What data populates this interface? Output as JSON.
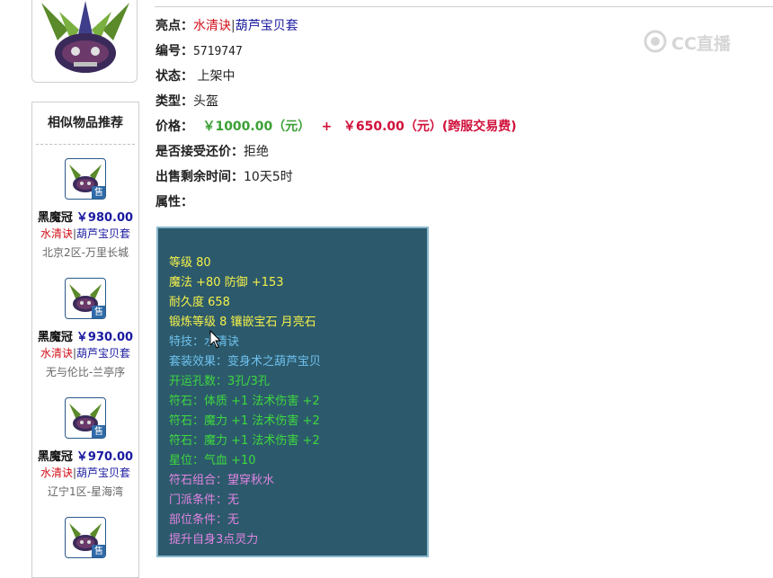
{
  "details": {
    "highlight_label": "亮点：",
    "highlight_tag1": "水清诀",
    "highlight_sep": "|",
    "highlight_tag2": "葫芦宝贝套",
    "id_label": "编号：",
    "id_value": "5719747",
    "status_label": "状态：",
    "status_value": " 上架中",
    "type_label": "类型：",
    "type_value": "头盔",
    "price_label": "价格：",
    "price_main": "￥1000.00（元）",
    "price_plus": "+",
    "price_fee": "￥650.00（元）(跨服交易费)",
    "bargain_label": "是否接受还价：",
    "bargain_value": "拒绝",
    "remaining_label": "出售剩余时间：",
    "remaining_value": "10天5时",
    "attributes_label": "属性："
  },
  "attributes": [
    "等级 80",
    "魔法 +80 防御 +153",
    "耐久度 658",
    "锻炼等级 8 镶嵌宝石 月亮石",
    "特技：水清诀",
    "套装效果：变身术之葫芦宝贝",
    "开运孔数：3孔/3孔",
    "符石：体质 +1 法术伤害 +2",
    "符石：魔力 +1 法术伤害 +2",
    "符石：魔力 +1 法术伤害 +2",
    "星位：气血 +10",
    "符石组合：望穿秋水",
    "门派条件：无",
    "部位条件：无",
    "提升自身3点灵力"
  ],
  "sidebar": {
    "title": "相似物品推荐",
    "items": [
      {
        "name": "黑魔冠",
        "price": "￥980.00",
        "tag1": "水清诀",
        "sep": "|",
        "tag2": "葫芦宝贝套",
        "server": "北京2区-万里长城",
        "badge": "售"
      },
      {
        "name": "黑魔冠",
        "price": "￥930.00",
        "tag1": "水清诀",
        "sep": "|",
        "tag2": "葫芦宝贝套",
        "server": "无与伦比-兰亭序",
        "badge": "售"
      },
      {
        "name": "黑魔冠",
        "price": "￥970.00",
        "tag1": "水清诀",
        "sep": "|",
        "tag2": "葫芦宝贝套",
        "server": "辽宁1区-星海湾",
        "badge": "售"
      },
      {
        "badge": "售"
      }
    ]
  },
  "watermark": {
    "text": "CC直播"
  },
  "colors": {
    "panel_bg": "#2c5a6c",
    "attr_yellow": "#f4f04a",
    "attr_cyan": "#6ec0ee",
    "attr_green": "#3ed83e",
    "attr_pink": "#e084e0",
    "price_green": "#3aa035",
    "price_red": "#d0103a",
    "link_blue": "#1a1aa0"
  },
  "icons": [
    "helmet-image",
    "sell-badge",
    "cc-live-logo",
    "mouse-cursor"
  ]
}
